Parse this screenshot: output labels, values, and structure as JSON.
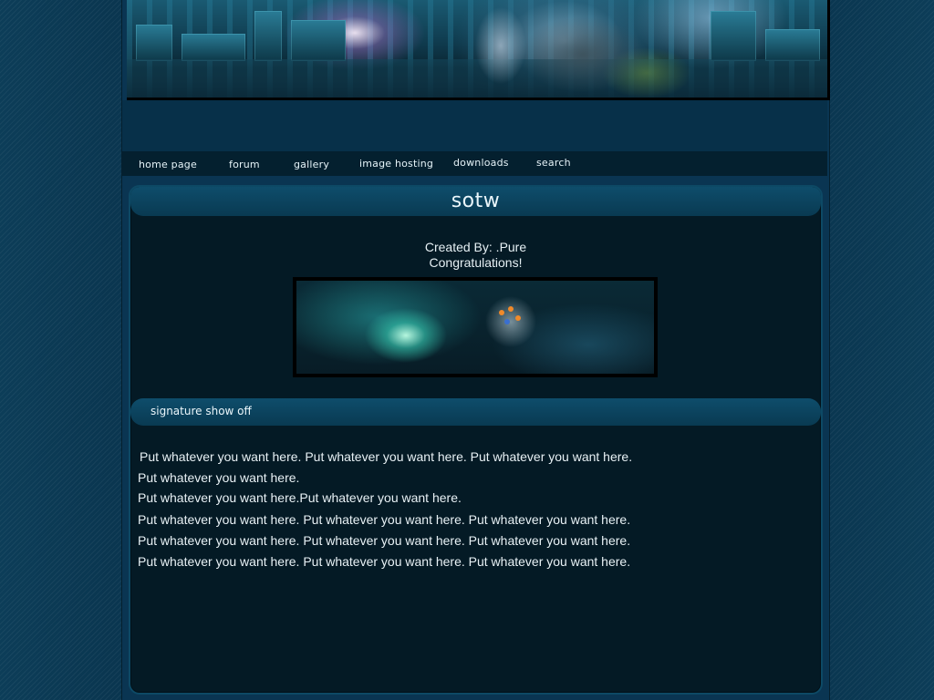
{
  "nav": {
    "items": [
      {
        "label": "home page"
      },
      {
        "label": "forum"
      },
      {
        "label": "gallery"
      },
      {
        "label": "image hosting"
      },
      {
        "label": "downloads"
      },
      {
        "label": "search"
      }
    ]
  },
  "sotw": {
    "title": "sotw",
    "created_by": "Created By: .Pure",
    "congrats": "Congratulations!"
  },
  "section": {
    "title": "signature show off",
    "lines": [
      "Put whatever you want here. Put whatever you want here. Put whatever you want here.",
      "Put whatever you want here.",
      "Put whatever you want here.Put whatever you want here.",
      "Put whatever you want here. Put whatever you want here. Put whatever you want here.",
      "Put whatever you want here. Put whatever you want here. Put whatever you want here.",
      "Put whatever you want here. Put whatever you want here. Put whatever you want here."
    ]
  },
  "colors": {
    "background": "#0a3552",
    "panel": "#041a25",
    "header": "#0e4d6b",
    "text": "#e8f1f5"
  }
}
